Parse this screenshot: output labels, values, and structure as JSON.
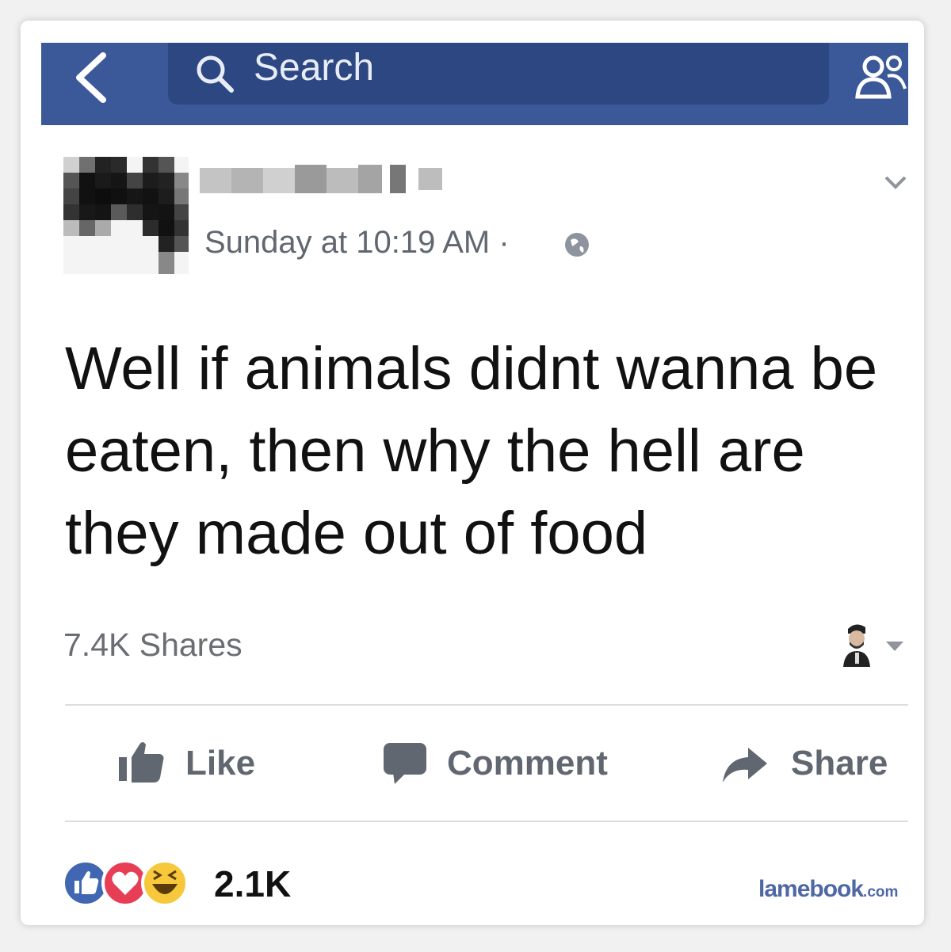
{
  "header": {
    "search_placeholder": "Search"
  },
  "post": {
    "timestamp": "Sunday at 10:19 AM",
    "separator": "·",
    "text": "Well if animals didnt wanna be eaten, then why the hell are they made out of food",
    "shares": "7.4K Shares"
  },
  "actions": {
    "like": "Like",
    "comment": "Comment",
    "share": "Share"
  },
  "reactions": {
    "count": "2.1K",
    "types": [
      "like",
      "love",
      "haha"
    ]
  },
  "watermark": {
    "name": "lamebook",
    "tld": ".com"
  },
  "colors": {
    "topbar": "#3b5998",
    "search_bg": "#2c4782",
    "like_blue": "#4267b2",
    "love_red": "#e83e55",
    "haha_yellow": "#f7c83b",
    "action_gray": "#616770",
    "watermark": "#4e67a5"
  },
  "icons": [
    "back-chevron-icon",
    "search-icon",
    "friend-requests-icon",
    "globe-icon",
    "post-options-chevron-icon",
    "caret-down-icon",
    "thumbs-up-icon",
    "comment-bubble-icon",
    "share-arrow-icon"
  ]
}
